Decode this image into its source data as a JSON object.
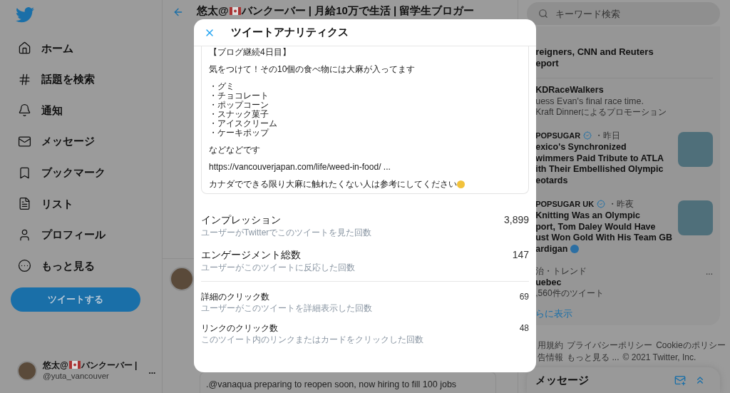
{
  "sidebar": {
    "nav": [
      {
        "label": "ホーム"
      },
      {
        "label": "話題を検索"
      },
      {
        "label": "通知"
      },
      {
        "label": "メッセージ"
      },
      {
        "label": "ブックマーク"
      },
      {
        "label": "リスト"
      },
      {
        "label": "プロフィール"
      },
      {
        "label": "もっと見る"
      }
    ],
    "tweet_button": "ツイートする",
    "account": {
      "name_before": "悠太@",
      "name_after": "バンクーバー |",
      "handle": "@yuta_vancouver",
      "more": "..."
    }
  },
  "profile_header": {
    "title_before": "悠太@",
    "title_after": "バンクーバー | 月給10万で生活 | 留学生ブロガー"
  },
  "timeline": {
    "tweet_text": ".@vanaqua preparing to reopen soon, now hiring to fill 100 jobs"
  },
  "search": {
    "placeholder": "キーワード検索"
  },
  "trends": [
    {
      "kind": "news",
      "lines": [
        "reigners, CNN and Reuters",
        "eport"
      ]
    },
    {
      "kind": "promo",
      "title": "KDRaceWalkers",
      "text": "uess Evan's final race time.",
      "promo": "Kraft Dinnerによるプロモーション"
    },
    {
      "kind": "story",
      "source": "POPSUGAR",
      "time": "・昨日",
      "lines": [
        "exico's Synchronized",
        "wimmers Paid Tribute to ATLA",
        "ith Their Embellished Olympic",
        "eotards"
      ]
    },
    {
      "kind": "story",
      "source": "POPSUGAR UK",
      "time": "・昨夜",
      "lines": [
        "Knitting Was an Olympic",
        "port, Tom Daley Would Have",
        "ust Won Gold With His Team GB",
        "ardigan"
      ]
    },
    {
      "kind": "trend",
      "context": "治・トレンド",
      "title": "uebec",
      "count": ",560件のツイート",
      "more": "..."
    }
  ],
  "show_more": "らに表示",
  "footer": [
    [
      "用規約",
      "プライバシーポリシー",
      "Cookieのポリシー"
    ],
    [
      "告情報",
      "もっと見る ...",
      "© 2021 Twitter, Inc."
    ]
  ],
  "messages_drawer": {
    "title": "メッセージ"
  },
  "analytics": {
    "title": "ツイートアナリティクス",
    "tweet_paragraphs": [
      [
        "【ブログ継続4日目】"
      ],
      [
        "気をつけて！その10個の食べ物には大麻が入ってます"
      ],
      [
        "・グミ",
        "・チョコレート",
        "・ポップコーン",
        "・スナック菓子",
        "・アイスクリーム",
        "・ケーキポップ"
      ],
      [
        "などなどです"
      ],
      [
        "https://vancouverjapan.com/life/weed-in-food/ ..."
      ],
      [
        "カナダでできる限り大麻に触れたくない人は参考にしてください"
      ]
    ],
    "metrics": [
      {
        "kind": "major",
        "label": "インプレッション",
        "description": "ユーザーがTwitterでこのツイートを見た回数",
        "value": "3,899"
      },
      {
        "kind": "major",
        "label": "エンゲージメント総数",
        "description": "ユーザーがこのツイートに反応した回数",
        "value": "147"
      },
      {
        "kind": "minor",
        "label": "詳細のクリック数",
        "description": "ユーザーがこのツイートを詳細表示した回数",
        "value": "69"
      },
      {
        "kind": "minor",
        "label": "リンクのクリック数",
        "description": "このツイート内のリンクまたはカードをクリックした回数",
        "value": "48"
      }
    ]
  }
}
